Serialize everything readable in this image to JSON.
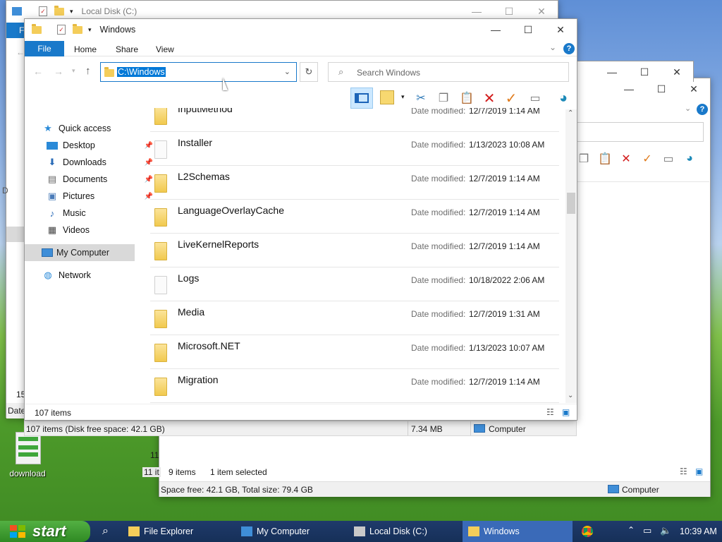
{
  "desktop": {
    "icon_label": "download"
  },
  "back_window3": {
    "status_left": "9 items",
    "status_selected": "1 item selected",
    "status_space": "Space free: 42.1 GB, Total size: 79.4 GB",
    "status_computer": "Computer",
    "row_frag_1": "11",
    "row_frag_2": "11 it"
  },
  "back_window1": {
    "title": "Local Disk (C:)",
    "status_left": "107 items (Disk free space: 42.1 GB)",
    "status_size": "7.34 MB",
    "status_computer": "Computer",
    "ribbon_frag": "F",
    "frag_d": "D",
    "frag_15": "15",
    "frag_date": "Date"
  },
  "main_window": {
    "title": "Windows",
    "tabs": [
      "File",
      "Home",
      "Share",
      "View"
    ],
    "address": "C:\\Windows",
    "search_placeholder": "Search Windows",
    "nav": {
      "quick_access": "Quick access",
      "desktop": "Desktop",
      "downloads": "Downloads",
      "documents": "Documents",
      "pictures": "Pictures",
      "music": "Music",
      "videos": "Videos",
      "my_computer": "My Computer",
      "network": "Network"
    },
    "partial_row": {
      "name": "InputMethod",
      "label": "Date modified:",
      "date": "12/7/2019 1:14 AM"
    },
    "date_label": "Date modified:",
    "rows": [
      {
        "name": "Installer",
        "date": "1/13/2023 10:08 AM"
      },
      {
        "name": "L2Schemas",
        "date": "12/7/2019 1:14 AM"
      },
      {
        "name": "LanguageOverlayCache",
        "date": "12/7/2019 1:14 AM"
      },
      {
        "name": "LiveKernelReports",
        "date": "12/7/2019 1:14 AM"
      },
      {
        "name": "Logs",
        "date": "10/18/2022 2:06 AM"
      },
      {
        "name": "Media",
        "date": "12/7/2019 1:31 AM"
      },
      {
        "name": "Microsoft.NET",
        "date": "1/13/2023 10:07 AM"
      },
      {
        "name": "Migration",
        "date": "12/7/2019 1:14 AM"
      }
    ],
    "status_items": "107 items"
  },
  "taskbar": {
    "start": "start",
    "items": [
      "File Explorer",
      "My Computer",
      "Local Disk (C:)",
      "Windows"
    ],
    "clock": "10:39 AM"
  },
  "colors": {
    "accent": "#1979ca",
    "selection": "#cce8ff",
    "taskbar": "#1f3a6b",
    "active_task": "#3a6ab8",
    "start": "#3c9a2f"
  },
  "icons": [
    "folder-icon",
    "check-doc-icon",
    "chevron-down-icon",
    "minimize-icon",
    "maximize-icon",
    "close-icon",
    "help-icon",
    "back-arrow-icon",
    "forward-arrow-icon",
    "up-arrow-icon",
    "refresh-icon",
    "search-icon",
    "preview-pane-icon",
    "layout-icon",
    "cut-icon",
    "copy-icon",
    "paste-icon",
    "delete-icon",
    "check-icon",
    "rename-icon",
    "globe-icon",
    "star-icon",
    "pin-icon",
    "computer-icon",
    "network-icon",
    "windows-logo-icon",
    "chrome-icon",
    "speaker-icon",
    "network-tray-icon"
  ]
}
